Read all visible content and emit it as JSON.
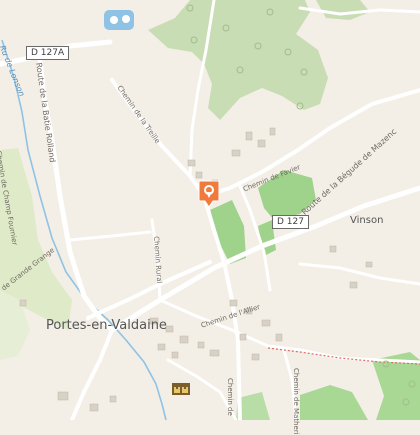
{
  "colors": {
    "background": "#f3efe6",
    "forest": "#c9ddb5",
    "vineyard": "#9fd28a",
    "water": "#8ec3e6",
    "road": "#ffffff",
    "marker": "#f07a3c",
    "hiking_path": "#e06b6b"
  },
  "map": {
    "places": {
      "town": "Portes-en-Valdaine",
      "hamlet": "Vinson"
    },
    "roads": {
      "d127a": "D 127A",
      "d127": "D 127",
      "route_batie": "Route de la Batie Rolland",
      "route_begude": "Route de la Bégude de Mazenc",
      "chemin_treille": "Chemin de la Treille",
      "chemin_favier": "Chemin de Favier",
      "chemin_rural": "Chemin Rural",
      "chemin_allier": "Chemin de l'Allier",
      "chemin_matheri": "Chemin de Matheri",
      "chemin_champ_fournier": "Chemin de Champ Fournier",
      "chemin_grande_grange": "de Grande Grange",
      "chemin_bottom": "Chemin de"
    },
    "water": {
      "stream": "Ru de Lonson"
    },
    "marker_icon": "map-pin-icon",
    "castle_icon": "castle-icon"
  }
}
